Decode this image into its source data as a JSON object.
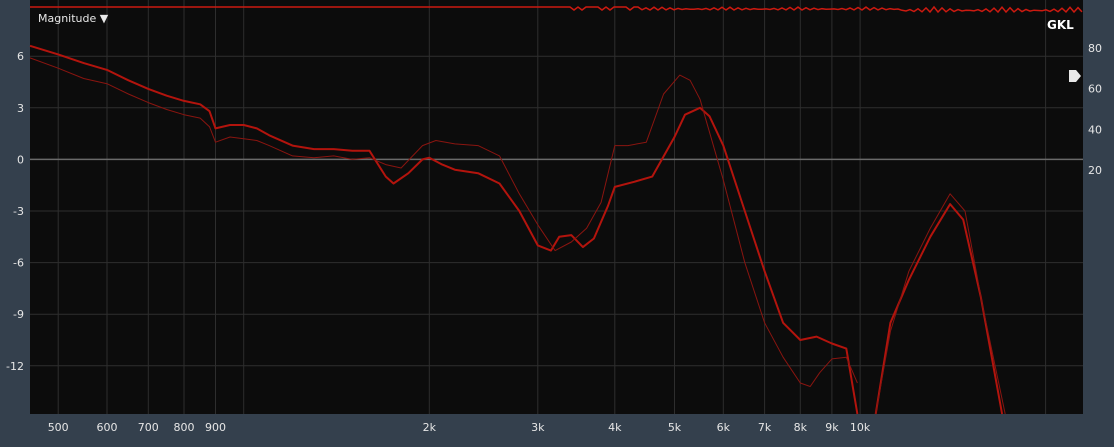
{
  "header": {
    "view_menu_label": "Magnitude ▼",
    "channel_label": "GKL"
  },
  "colors": {
    "plot_bg": "#0c0c0c",
    "frame_bg": "#34404d",
    "grid": "#2e2e2e",
    "zero_line": "#6a6a6a",
    "trace_main": "#b3140d",
    "trace_secondary": "#8a1510",
    "top_trace": "#cc1a10"
  },
  "chart_data": {
    "type": "line",
    "x_scale": "log",
    "xlim": [
      450,
      23000
    ],
    "ylim": [
      -14.8,
      8.8
    ],
    "x_ticks": [
      {
        "value": 500,
        "label": "500"
      },
      {
        "value": 600,
        "label": "600"
      },
      {
        "value": 700,
        "label": "700"
      },
      {
        "value": 800,
        "label": "800"
      },
      {
        "value": 900,
        "label": "900"
      },
      {
        "value": 2000,
        "label": "2k"
      },
      {
        "value": 3000,
        "label": "3k"
      },
      {
        "value": 4000,
        "label": "4k"
      },
      {
        "value": 5000,
        "label": "5k"
      },
      {
        "value": 6000,
        "label": "6k"
      },
      {
        "value": 7000,
        "label": "7k"
      },
      {
        "value": 8000,
        "label": "8k"
      },
      {
        "value": 9000,
        "label": "9k"
      },
      {
        "value": 10000,
        "label": "10k"
      }
    ],
    "x_gridlines": [
      500,
      600,
      700,
      800,
      900,
      1000,
      2000,
      3000,
      4000,
      5000,
      6000,
      7000,
      8000,
      9000,
      10000,
      20000
    ],
    "y_ticks": [
      {
        "value": 6,
        "label": "6"
      },
      {
        "value": 3,
        "label": "3"
      },
      {
        "value": 0,
        "label": "0"
      },
      {
        "value": -3,
        "label": "-3"
      },
      {
        "value": -6,
        "label": "-6"
      },
      {
        "value": -9,
        "label": "-9"
      },
      {
        "value": -12,
        "label": "-12"
      }
    ],
    "right_scale": {
      "ticks": [
        {
          "value": 80,
          "label": "80"
        },
        {
          "value": 60,
          "label": "60"
        },
        {
          "value": 40,
          "label": "40"
        },
        {
          "value": 20,
          "label": "20"
        }
      ],
      "handle_value": 66
    },
    "grid": true,
    "series": [
      {
        "role": "main",
        "width": 2,
        "points": [
          [
            450,
            6.6
          ],
          [
            500,
            6.1
          ],
          [
            550,
            5.6
          ],
          [
            600,
            5.2
          ],
          [
            650,
            4.6
          ],
          [
            700,
            4.1
          ],
          [
            750,
            3.7
          ],
          [
            800,
            3.4
          ],
          [
            850,
            3.2
          ],
          [
            880,
            2.8
          ],
          [
            900,
            1.8
          ],
          [
            950,
            2.0
          ],
          [
            1000,
            2.0
          ],
          [
            1050,
            1.8
          ],
          [
            1100,
            1.4
          ],
          [
            1200,
            0.8
          ],
          [
            1300,
            0.6
          ],
          [
            1400,
            0.6
          ],
          [
            1500,
            0.5
          ],
          [
            1600,
            0.5
          ],
          [
            1700,
            -1.0
          ],
          [
            1750,
            -1.4
          ],
          [
            1850,
            -0.8
          ],
          [
            1950,
            0.0
          ],
          [
            2000,
            0.1
          ],
          [
            2100,
            -0.3
          ],
          [
            2200,
            -0.6
          ],
          [
            2400,
            -0.8
          ],
          [
            2600,
            -1.4
          ],
          [
            2800,
            -3.0
          ],
          [
            3000,
            -5.0
          ],
          [
            3150,
            -5.3
          ],
          [
            3250,
            -4.5
          ],
          [
            3400,
            -4.4
          ],
          [
            3550,
            -5.1
          ],
          [
            3700,
            -4.6
          ],
          [
            3900,
            -2.7
          ],
          [
            4000,
            -1.6
          ],
          [
            4300,
            -1.3
          ],
          [
            4600,
            -1.0
          ],
          [
            5000,
            1.3
          ],
          [
            5200,
            2.6
          ],
          [
            5500,
            3.0
          ],
          [
            5700,
            2.5
          ],
          [
            6000,
            0.8
          ],
          [
            6500,
            -3.0
          ],
          [
            7000,
            -6.5
          ],
          [
            7500,
            -9.5
          ],
          [
            8000,
            -10.5
          ],
          [
            8500,
            -10.3
          ],
          [
            9000,
            -10.7
          ],
          [
            9500,
            -11.0
          ],
          [
            9900,
            -14.8
          ]
        ]
      },
      {
        "role": "main",
        "width": 2,
        "points": [
          [
            10600,
            -14.8
          ],
          [
            11200,
            -9.5
          ],
          [
            12000,
            -7.0
          ],
          [
            13000,
            -4.5
          ],
          [
            14000,
            -2.6
          ],
          [
            14700,
            -3.5
          ],
          [
            15700,
            -8.0
          ],
          [
            17000,
            -14.8
          ]
        ]
      },
      {
        "role": "secondary",
        "width": 1,
        "points": [
          [
            450,
            5.9
          ],
          [
            500,
            5.3
          ],
          [
            550,
            4.7
          ],
          [
            600,
            4.4
          ],
          [
            650,
            3.8
          ],
          [
            700,
            3.3
          ],
          [
            750,
            2.9
          ],
          [
            800,
            2.6
          ],
          [
            850,
            2.4
          ],
          [
            880,
            1.9
          ],
          [
            900,
            1.0
          ],
          [
            950,
            1.3
          ],
          [
            1000,
            1.2
          ],
          [
            1050,
            1.1
          ],
          [
            1100,
            0.8
          ],
          [
            1200,
            0.2
          ],
          [
            1300,
            0.1
          ],
          [
            1400,
            0.2
          ],
          [
            1500,
            0.0
          ],
          [
            1600,
            0.1
          ],
          [
            1700,
            -0.3
          ],
          [
            1800,
            -0.5
          ],
          [
            1950,
            0.8
          ],
          [
            2050,
            1.1
          ],
          [
            2200,
            0.9
          ],
          [
            2400,
            0.8
          ],
          [
            2600,
            0.2
          ],
          [
            2800,
            -2.0
          ],
          [
            3000,
            -3.8
          ],
          [
            3200,
            -5.3
          ],
          [
            3400,
            -4.8
          ],
          [
            3600,
            -4.0
          ],
          [
            3800,
            -2.5
          ],
          [
            4000,
            0.8
          ],
          [
            4200,
            0.8
          ],
          [
            4500,
            1.0
          ],
          [
            4800,
            3.8
          ],
          [
            5100,
            4.9
          ],
          [
            5300,
            4.6
          ],
          [
            5500,
            3.5
          ],
          [
            6000,
            -1.2
          ],
          [
            6500,
            -6.0
          ],
          [
            7000,
            -9.5
          ],
          [
            7500,
            -11.5
          ],
          [
            8000,
            -13.0
          ],
          [
            8300,
            -13.2
          ],
          [
            8600,
            -12.4
          ],
          [
            9000,
            -11.6
          ],
          [
            9500,
            -11.5
          ],
          [
            9900,
            -13.0
          ]
        ]
      },
      {
        "role": "secondary",
        "width": 1,
        "points": [
          [
            10600,
            -14.8
          ],
          [
            11200,
            -10.0
          ],
          [
            12000,
            -6.5
          ],
          [
            13000,
            -4.0
          ],
          [
            14000,
            -2.0
          ],
          [
            14800,
            -3.0
          ],
          [
            15800,
            -8.5
          ],
          [
            17200,
            -14.8
          ]
        ]
      }
    ]
  }
}
